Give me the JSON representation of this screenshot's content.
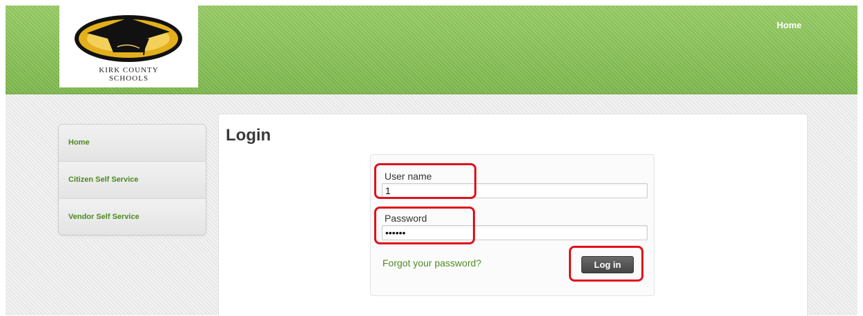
{
  "header": {
    "logo_line1": "KIRK COUNTY",
    "logo_line2": "SCHOOLS",
    "nav_home": "Home"
  },
  "sidebar": {
    "items": [
      {
        "label": "Home"
      },
      {
        "label": "Citizen Self Service"
      },
      {
        "label": "Vendor Self Service"
      }
    ]
  },
  "main": {
    "title": "Login",
    "username": {
      "label": "User name",
      "value": "1"
    },
    "password": {
      "label": "Password",
      "value": "••••••"
    },
    "forgot_link": "Forgot your password?",
    "login_button": "Log in"
  },
  "colors": {
    "header_green": "#8cc25a",
    "link_green": "#4f8a25",
    "highlight_red": "#e0101c",
    "button_dark": "#4a4a4a"
  }
}
